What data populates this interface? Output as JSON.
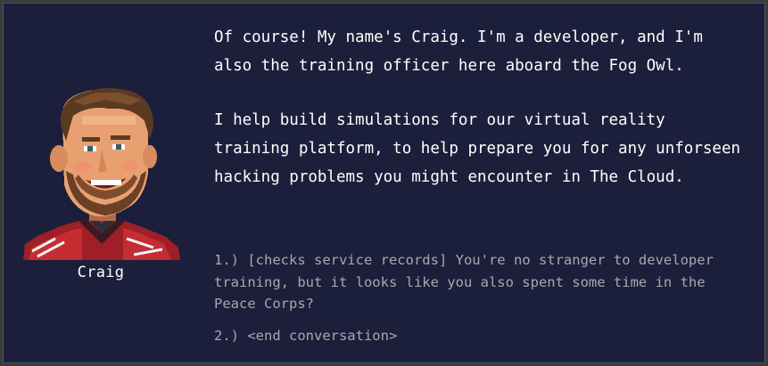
{
  "colors": {
    "panel_bg": "#1c1f3b",
    "speech_text": "#ffffff",
    "option_text": "#a8a8ad"
  },
  "speaker": {
    "name": "Craig",
    "portrait": "pixel-art-portrait-bearded-man-smiling-red-jacket"
  },
  "speech": {
    "paragraphs": [
      "Of course! My name's Craig. I'm a developer, and I'm also the training officer here aboard the Fog Owl.",
      "I help build simulations for our virtual reality training platform, to help prepare you for any unforseen hacking problems you might encounter in The Cloud."
    ]
  },
  "options": [
    "1.) [checks service records] You're no stranger to developer training, but it looks like you also spent some time in the Peace Corps?",
    "2.) <end conversation>"
  ]
}
